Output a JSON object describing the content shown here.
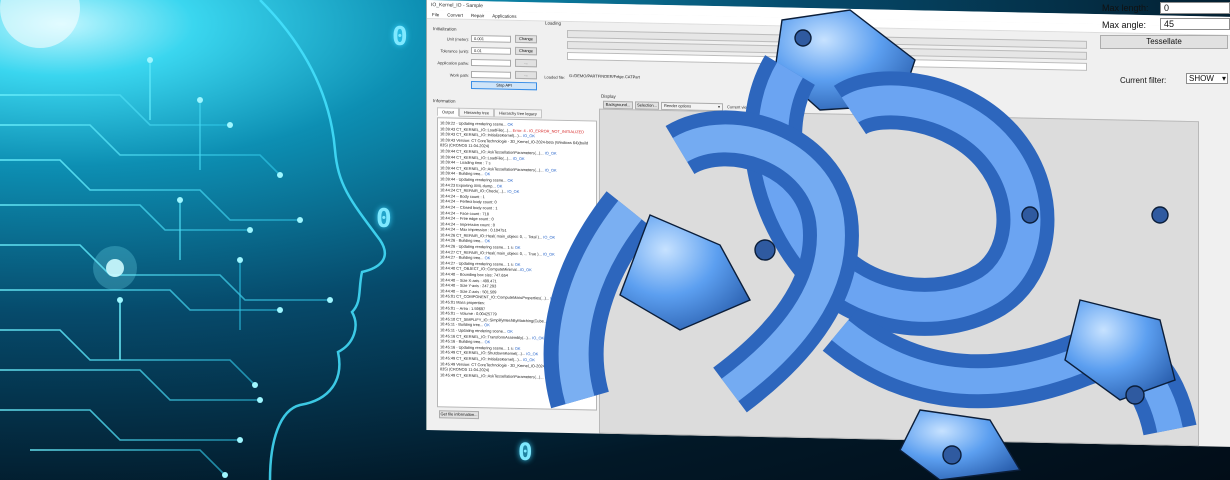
{
  "background": {
    "digits": [
      "0",
      "0",
      "0"
    ],
    "accent_color": "#3ad6ef"
  },
  "window": {
    "title": "IO_Kernel_IO - Sample",
    "menu": [
      "File",
      "Convert",
      "Repair",
      "Applications"
    ],
    "initialization": {
      "title": "Initialization",
      "unit_label": "Unit (meter):",
      "unit_value": "0.001",
      "tolerance_label": "Tolerance (unit):",
      "tolerance_value": "0.01",
      "app_paths_label": "Application paths:",
      "work_path_label": "Work path:",
      "change_label": "Change",
      "browse_label": "...",
      "stop_api_label": "Stop API"
    },
    "loading": {
      "title": "Loading",
      "options_label": "Options...",
      "loaded_file_label": "Loaded file:",
      "loaded_file_value": "G:/DEMO/PARTFINDER/Felge.CATPart"
    },
    "information": {
      "title": "Information",
      "tabs": [
        "Output",
        "Hierarchy tree",
        "Hierarchy tree legacy"
      ],
      "get_file_info_label": "Get file information..."
    },
    "display": {
      "title": "Display",
      "background_btn": "Background...",
      "selection_btn": "Selection...",
      "render_options": "Render options",
      "current_view": "Current view"
    },
    "tessellation": {
      "max_length_label": "Max length:",
      "max_length_value": "0",
      "max_angle_label": "Max angle:",
      "max_angle_value": "45",
      "tessellate_label": "Tessellate"
    },
    "filter": {
      "label": "Current filter:",
      "value": "SHOW"
    }
  },
  "log_lines": [
    {
      "t": "10:39:22 - Updating rendering scene... ",
      "s": "OK",
      "c": "ok"
    },
    {
      "t": "10:39:43   CT_KERNEL_IO::LoadFile(...)... ",
      "s": "Error: 4 - IO_ERROR_NOT_INITIALIZED",
      "c": "err"
    },
    {
      "t": "10:39:43   CT_KERNEL_IO::InitializeKernel(...)... ",
      "s": "IO_OK",
      "c": "ok"
    },
    {
      "t": "10:39:43   Version: CT CoreTechnologie - 3D_Kernel_IO-2024-beta (Windows 64)(build",
      "s": "",
      "c": ""
    },
    {
      "t": "835) (CRONOS 11-04-2024)",
      "s": "",
      "c": ""
    },
    {
      "t": "10:39:44   CT_KERNEL_IO::AskTessellationParameters(...)... ",
      "s": "IO_OK",
      "c": "ok"
    },
    {
      "t": "10:39:44   CT_KERNEL_IO::LoadFile(...)... ",
      "s": "IO_OK",
      "c": "ok"
    },
    {
      "t": "10:39:44   -- Loading time : 7 s",
      "s": "",
      "c": ""
    },
    {
      "t": "10:39:44   CT_KERNEL_IO::AskTessellationParameters(...)... ",
      "s": "IO_OK",
      "c": "ok"
    },
    {
      "t": "10:39:44 - Building tree... ",
      "s": "OK",
      "c": "ok"
    },
    {
      "t": "10:39:44 - Updating rendering scene... ",
      "s": "OK",
      "c": "ok"
    },
    {
      "t": "10:44:23   Exporting XML dump... ",
      "s": "OK",
      "c": "ok"
    },
    {
      "t": "10:44:24   CT_REPAIR_IO::Check(...)... ",
      "s": "IO_OK",
      "c": "ok"
    },
    {
      "t": "10:44:24   -- Body count                : 1",
      "s": "",
      "c": ""
    },
    {
      "t": "10:44:24   -- Perfect body count: 0",
      "s": "",
      "c": ""
    },
    {
      "t": "10:44:24   -- Closed body count          : 1",
      "s": "",
      "c": ""
    },
    {
      "t": "10:44:24   -- Face count             : 718",
      "s": "",
      "c": ""
    },
    {
      "t": "10:44:24   -- Free edge count         : 0",
      "s": "",
      "c": ""
    },
    {
      "t": "10:44:24   -- Impression count : 0",
      "s": "",
      "c": ""
    },
    {
      "t": "10:44:24   -- Max impression      : 0.104751",
      "s": "",
      "c": ""
    },
    {
      "t": "10:44:26   CT_REPAIR_IO::Heal( main_object: 0, ... Total )... ",
      "s": "IO_OK",
      "c": "ok"
    },
    {
      "t": "10:44:26 - Building tree... ",
      "s": "OK",
      "c": "ok"
    },
    {
      "t": "10:44:26 - Updating rendering scene... 1 s: ",
      "s": "OK",
      "c": "ok"
    },
    {
      "t": "10:44:27   CT_REPAIR_IO::Heal( main_object: 0, ... True )... ",
      "s": "IO_OK",
      "c": "ok"
    },
    {
      "t": "10:44:27 - Building tree... ",
      "s": "OK",
      "c": "ok"
    },
    {
      "t": "10:44:27 - Updating rendering scene... 1 s: ",
      "s": "OK",
      "c": "ok"
    },
    {
      "t": "10:44:40   CT_OBJECT_IO::ComputeMinimal...",
      "s": "IO_OK",
      "c": "ok"
    },
    {
      "t": "10:44:40   -- Bounding box size: 747.654",
      "s": "",
      "c": ""
    },
    {
      "t": "10:44:40   -- Size X-axis          : 499.471",
      "s": "",
      "c": ""
    },
    {
      "t": "10:44:40   -- Size Y-axis          : 247.293",
      "s": "",
      "c": ""
    },
    {
      "t": "10:44:40   -- Size Z-axis          : 501.509",
      "s": "",
      "c": ""
    },
    {
      "t": "10:45:01   CT_COMPONENT_IO::ComputeMassProperties(...)... ",
      "s": "IO_OK",
      "c": "ok"
    },
    {
      "t": "10:45:01   Mass properties:",
      "s": "",
      "c": ""
    },
    {
      "t": "10:45:01   -- Area : 1.59697",
      "s": "",
      "c": ""
    },
    {
      "t": "10:45:01   -- Volume : 0.00425779",
      "s": "",
      "c": ""
    },
    {
      "t": "10:45:10   CT_SIMPLIFY_IO::SimplifyMeshByMatching(Cube... ",
      "s": "IO_OK",
      "c": "ok"
    },
    {
      "t": "10:45:11 - Building tree... ",
      "s": "OK",
      "c": "ok"
    },
    {
      "t": "10:45:11 - Updating rendering scene... ",
      "s": "OK",
      "c": "ok"
    },
    {
      "t": "10:45:16   CT_KERNEL_IO::TransformAssembly(...)... ",
      "s": "IO_OK",
      "c": "ok"
    },
    {
      "t": "10:45:16 - Building tree... ",
      "s": "OK",
      "c": "ok"
    },
    {
      "t": "10:45:16 - Updating rendering scene... 1 s: ",
      "s": "OK",
      "c": "ok"
    },
    {
      "t": "10:45:49   CT_KERNEL_IO::ShutdownKernel(...)... ",
      "s": "IO_OK",
      "c": "ok"
    },
    {
      "t": "10:45:49   CT_KERNEL_IO::InitializeKernel(...)... ",
      "s": "IO_OK",
      "c": "ok"
    },
    {
      "t": "10:45:49   Version: CT CoreTechnologie - 3D_Kernel_IO-2024-beta",
      "s": "",
      "c": ""
    },
    {
      "t": "835) (CRONOS 11-04-2024)",
      "s": "",
      "c": ""
    },
    {
      "t": "10:45:49   CT_KERNEL_IO::AskTessellationParameters(...)... ",
      "s": "IO_OK",
      "c": "ok"
    }
  ]
}
